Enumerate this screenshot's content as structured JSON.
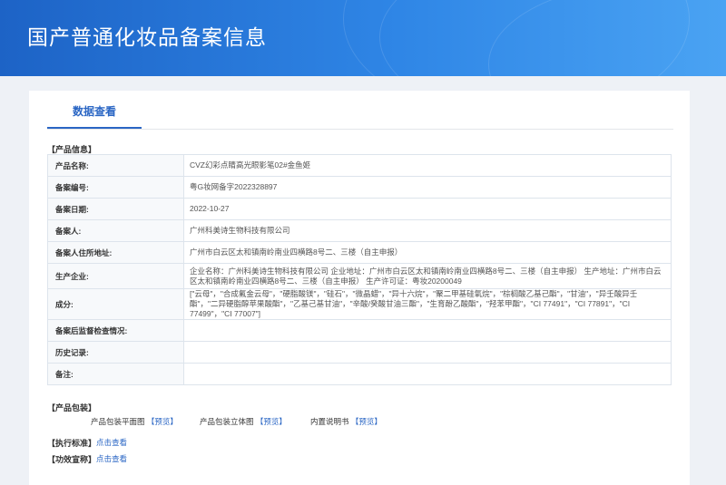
{
  "header": {
    "title": "国产普通化妆品备案信息"
  },
  "tabs": [
    {
      "label": "数据查看"
    }
  ],
  "product_section": {
    "title": "【产品信息】",
    "rows": [
      {
        "label": "产品名称:",
        "value": "CVZ幻彩点睛高光眼影笔02#金鱼姬"
      },
      {
        "label": "备案编号:",
        "value": "粤G妆网备字2022328897"
      },
      {
        "label": "备案日期:",
        "value": "2022-10-27"
      },
      {
        "label": "备案人:",
        "value": "广州科美诗生物科技有限公司"
      },
      {
        "label": "备案人住所地址:",
        "value": "广州市白云区太和镇南岭南业四横路8号二、三楼（自主申报）"
      },
      {
        "label": "生产企业:",
        "value": "企业名称：广州科美诗生物科技有限公司 企业地址：广州市白云区太和镇南岭南业四横路8号二、三楼（自主申报） 生产地址：广州市白云区太和镇南岭南业四横路8号二、三楼（自主申报） 生产许可证：粤妆20200049"
      },
      {
        "label": "成分:",
        "value": "[\"云母\"，\"合成氟金云母\"，\"硬脂酸镁\"，\"硅石\"，\"微晶蜡\"，\"异十六烷\"，\"聚二甲基硅氧烷\"，\"棕榈酸乙基己酯\"，\"甘油\"，\"异壬酸异壬酯\"，\"二异硬脂醇苹果酸酯\"，\"乙基己基甘油\"，\"辛酸/癸酸甘油三酯\"，\"生育酚乙酸酯\"，\"羟苯甲酯\"，\"CI 77491\"，\"CI 77891\"，\"CI 77499\"，\"CI 77007\"]"
      },
      {
        "label": "备案后监督检查情况:",
        "value": ""
      },
      {
        "label": "历史记录:",
        "value": ""
      },
      {
        "label": "备注:",
        "value": ""
      }
    ]
  },
  "packaging_section": {
    "title": "【产品包装】",
    "items": [
      {
        "label": "产品包装平面图",
        "link": "【预览】"
      },
      {
        "label": "产品包装立体图",
        "link": "【预览】"
      },
      {
        "label": "内置说明书",
        "link": "【预览】"
      }
    ]
  },
  "standard_section": {
    "title": "【执行标准】",
    "link": "点击查看"
  },
  "claims_section": {
    "title": "【功效宣称】",
    "link": "点击查看"
  },
  "colors": {
    "banner": "#2a7ad8",
    "accent": "#2a66c4",
    "table_border": "#a9c0dd"
  }
}
